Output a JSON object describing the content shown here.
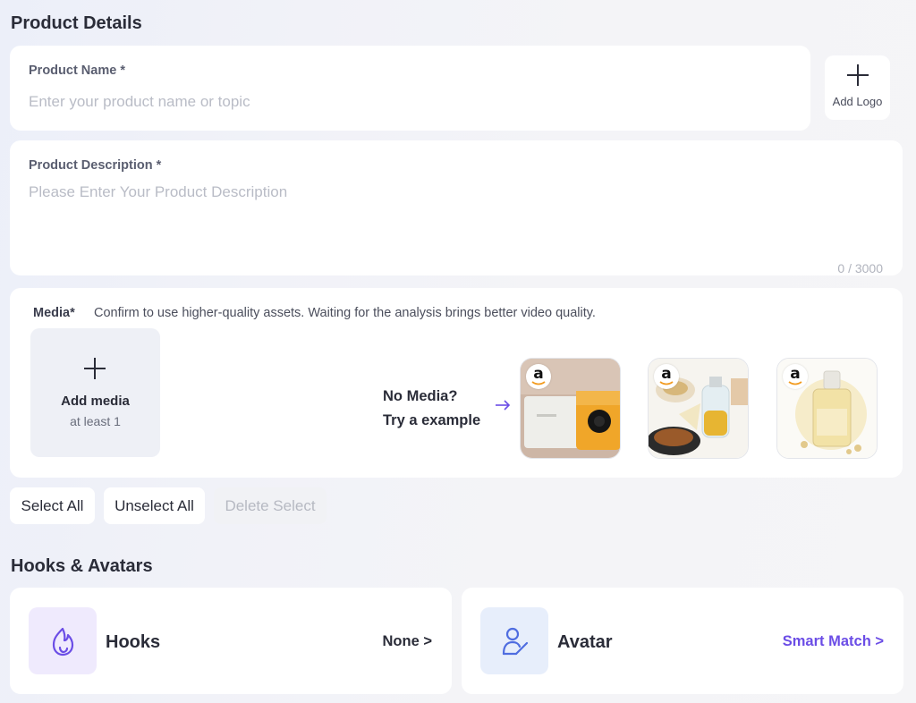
{
  "product_details": {
    "title": "Product Details",
    "name": {
      "label": "Product Name *",
      "placeholder": "Enter your product name or topic"
    },
    "logo": {
      "label": "Add Logo"
    },
    "description": {
      "label": "Product Description *",
      "placeholder": "Please Enter Your Product Description",
      "counter": "0 / 3000"
    }
  },
  "media": {
    "label": "Media*",
    "hint": "Confirm to use higher-quality assets. Waiting for the analysis brings better video quality.",
    "add_title": "Add media",
    "add_sub": "at least 1",
    "no_media_line1": "No Media?",
    "no_media_line2": "Try a example",
    "examples": [
      {
        "name": "projector",
        "badge": "a"
      },
      {
        "name": "cooking-oil-sprayer",
        "badge": "a"
      },
      {
        "name": "serum-bottle",
        "badge": "a"
      }
    ]
  },
  "selection": {
    "select_all": "Select All",
    "unselect_all": "Unselect All",
    "delete_select": "Delete Select"
  },
  "hooks_avatars": {
    "title": "Hooks & Avatars",
    "hooks": {
      "label": "Hooks",
      "value": "None >"
    },
    "avatar": {
      "label": "Avatar",
      "value": "Smart Match >"
    }
  },
  "colors": {
    "accent": "#6b4de6",
    "hooks_icon_bg": "#efeafd",
    "avatar_icon_bg": "#e7eefb",
    "avatar_icon": "#4f6de0"
  }
}
